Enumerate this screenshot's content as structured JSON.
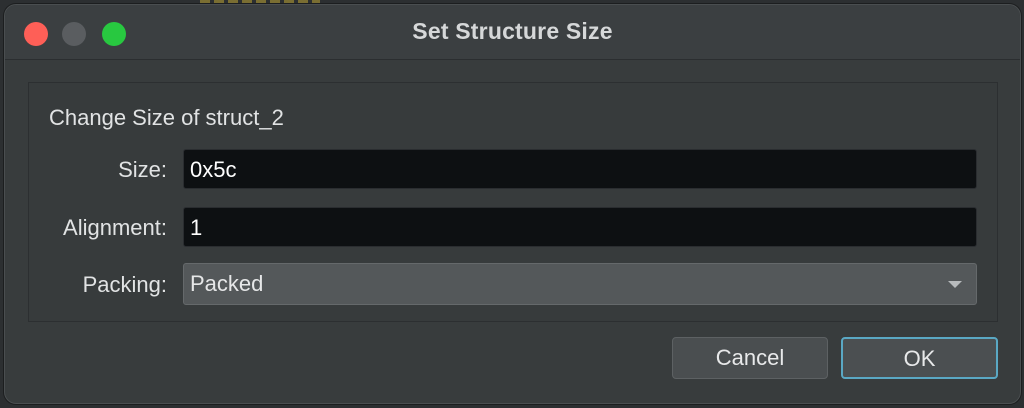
{
  "window": {
    "title": "Set Structure Size",
    "traffic_lights": {
      "close_color": "#fe5f57",
      "minimize_color": "#5a5d60",
      "zoom_color": "#28c840"
    }
  },
  "group": {
    "title": "Change Size of struct_2"
  },
  "fields": {
    "size": {
      "label": "Size:",
      "value": "0x5c"
    },
    "alignment": {
      "label": "Alignment:",
      "value": "1"
    },
    "packing": {
      "label": "Packing:",
      "selected": "Packed",
      "icon": "chevron-down-icon"
    }
  },
  "buttons": {
    "cancel_label": "Cancel",
    "ok_label": "OK"
  },
  "colors": {
    "focus_accent": "#5aa8c4"
  }
}
